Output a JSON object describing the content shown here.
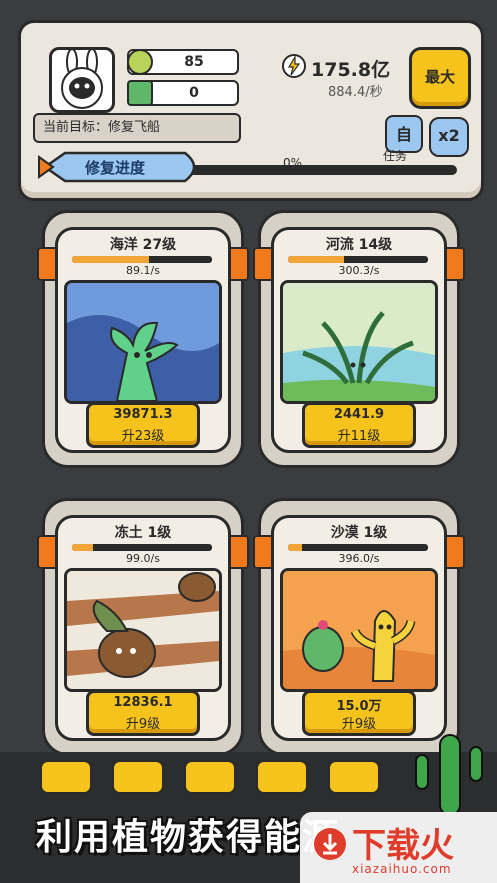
{
  "resources": {
    "leaf_count": "85",
    "crystal_count": "0"
  },
  "energy": {
    "total": "175.8亿",
    "rate": "884.4/秒"
  },
  "buttons": {
    "max_label": "最大",
    "task_label": "任务",
    "task_icon_text": "自",
    "multiplier_label": "x2"
  },
  "goal": {
    "text": "当前目标：修复飞船"
  },
  "repair": {
    "label": "修复进度",
    "percent_text": "0%",
    "progress": 0
  },
  "cards": [
    {
      "title": "海洋 27级",
      "rate": "89.1/s",
      "cost": "39871.3",
      "upgrade": "升23级",
      "progress": 0.55,
      "scene": "ocean"
    },
    {
      "title": "河流 14级",
      "rate": "300.3/s",
      "cost": "2441.9",
      "upgrade": "升11级",
      "progress": 0.4,
      "scene": "river"
    },
    {
      "title": "冻土 1级",
      "rate": "99.0/s",
      "cost": "12836.1",
      "upgrade": "升9级",
      "progress": 0.15,
      "scene": "tundra"
    },
    {
      "title": "沙漠 1级",
      "rate": "396.0/s",
      "cost": "15.0万",
      "upgrade": "升9级",
      "progress": 0.1,
      "scene": "desert"
    }
  ],
  "banner": {
    "slogan": "利用植物获得能源",
    "watermark_main": "下载火",
    "watermark_sub": "xiazaihuo.com"
  },
  "colors": {
    "accent_yellow": "#f6c21c",
    "accent_orange": "#f07a1c",
    "panel": "#ece7de"
  }
}
